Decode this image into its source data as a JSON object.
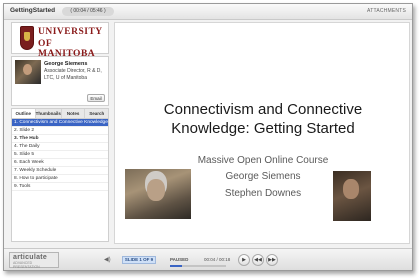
{
  "window": {
    "title": "GettingStarted",
    "time_display": "( 00:04 / 05:46 )",
    "attachments_label": "ATTACHMENTS"
  },
  "sidebar": {
    "logo": {
      "line1": "UNIVERSITY",
      "line2": "OF MANITOBA"
    },
    "presenter": {
      "name": "George Siemens",
      "role": "Associate Director, R & D, LTC, U of Manitoba",
      "email_label": "Email"
    },
    "tabs": [
      {
        "label": "Outline",
        "active": true
      },
      {
        "label": "Thumbnails",
        "active": false
      },
      {
        "label": "Notes",
        "active": false
      },
      {
        "label": "Search",
        "active": false
      }
    ],
    "outline": [
      {
        "label": "1. Connectivism and Connective Knowledge",
        "current": true
      },
      {
        "label": "2. Slide 2",
        "current": false
      },
      {
        "label": "3. The Hub",
        "current": false
      },
      {
        "label": "4. The Daily",
        "current": false
      },
      {
        "label": "5. Slide 5",
        "current": false
      },
      {
        "label": "6. Each Week",
        "current": false
      },
      {
        "label": "7. Weekly Schedule",
        "current": false
      },
      {
        "label": "8. How to participate",
        "current": false
      },
      {
        "label": "9. Tools",
        "current": false
      }
    ]
  },
  "slide": {
    "title_line1": "Connectivism and Connective",
    "title_line2": "Knowledge: Getting Started",
    "subtitle_line1": "Massive Open Online Course",
    "subtitle_line2": "George Siemens",
    "subtitle_line3": "Stephen Downes"
  },
  "player": {
    "brand_name": "articulate",
    "brand_sub": "ADVANCED PRESENTATION",
    "volume_icon": "speaker-icon",
    "slide_counter": "SLIDE 1 OF 9",
    "status": "PAUSED",
    "time": "00:04 / 00:18",
    "progress": 0.22,
    "play_icon": "play-icon",
    "prev_icon": "previous-icon",
    "next_icon": "next-icon"
  },
  "colors": {
    "highlight": "#3a64c4",
    "university": "#8a1a1a"
  }
}
